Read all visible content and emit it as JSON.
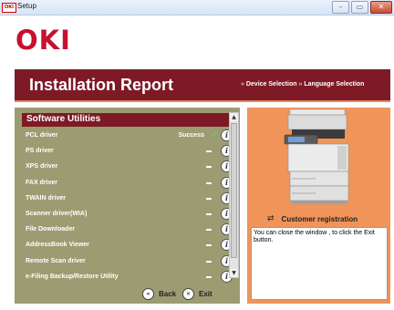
{
  "window": {
    "title": "Setup",
    "icon_text": "OKI",
    "controls": {
      "minimize": "–",
      "maximize": "▭",
      "close": "✕"
    }
  },
  "brand": {
    "logo": "OKI"
  },
  "header": {
    "title": "Installation Report",
    "breadcrumb": {
      "sep1": "»",
      "item1": "Device Selection",
      "sep2": "»",
      "item2": "Language Selection"
    }
  },
  "utilities": {
    "title": "Software Utilities",
    "items": [
      {
        "name": "PCL driver",
        "status": "Success",
        "state": "success"
      },
      {
        "name": "PS driver",
        "state": "none"
      },
      {
        "name": "XPS driver",
        "state": "none"
      },
      {
        "name": "FAX driver",
        "state": "none"
      },
      {
        "name": "TWAIN driver",
        "state": "none"
      },
      {
        "name": "Scanner driver(WIA)",
        "state": "none"
      },
      {
        "name": "File Downloader",
        "state": "none"
      },
      {
        "name": "AddressBook Viewer",
        "state": "none"
      },
      {
        "name": "Remote Scan driver",
        "state": "none"
      },
      {
        "name": "e-Filing Backup/Restore Utility",
        "state": "none"
      }
    ],
    "info_icon": "i",
    "success_color": "#5fd35f"
  },
  "nav": {
    "back_label": "Back",
    "back_icon": "«",
    "exit_label": "Exit",
    "exit_icon": "✕"
  },
  "side": {
    "registration_label": "Customer registration",
    "registration_icon": "⇄",
    "message": "You can close the window , to click the Exit button."
  },
  "colors": {
    "brand_red": "#c8102e",
    "header_bg": "#7d1a26",
    "panel_bg": "#9c9c72",
    "side_bg": "#f0945a"
  }
}
